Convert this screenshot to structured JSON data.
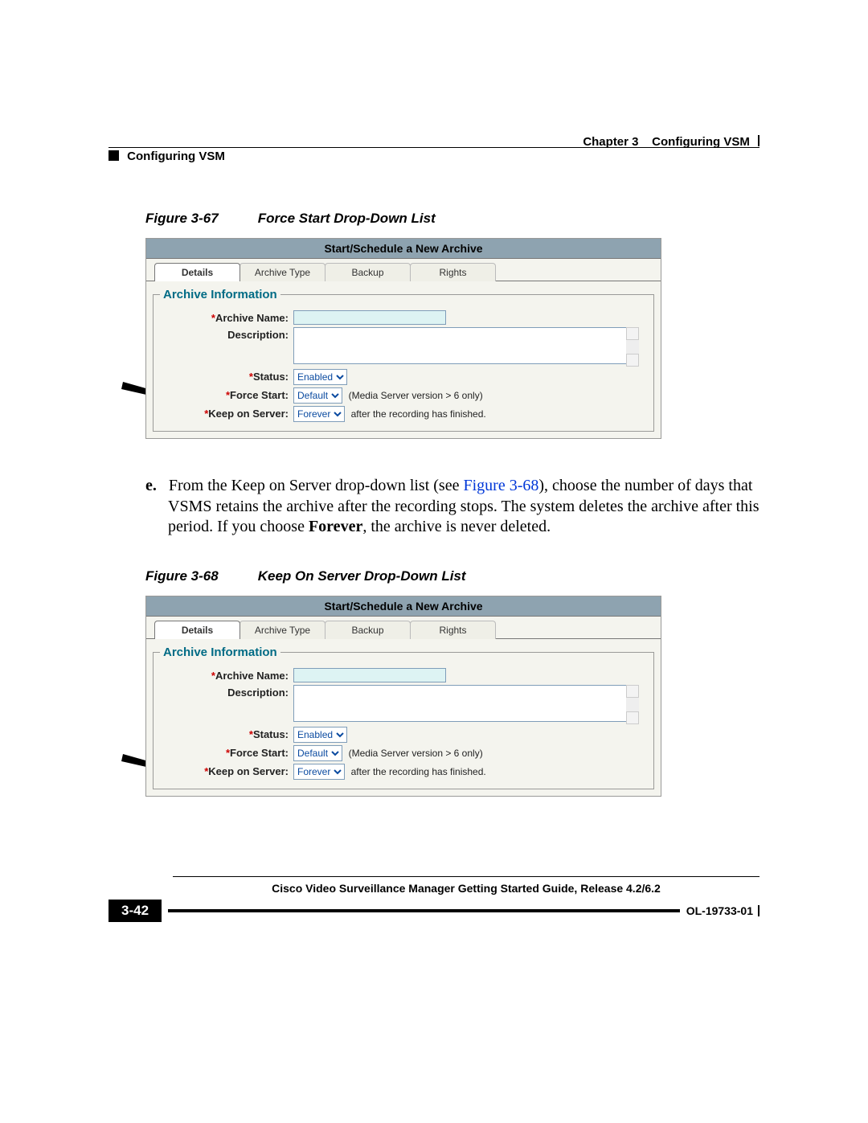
{
  "header": {
    "chapter": "Chapter 3",
    "section_right": "Configuring VSM",
    "section_left": "Configuring VSM"
  },
  "figures": {
    "f67": {
      "num": "Figure 3-67",
      "title": "Force Start Drop-Down List"
    },
    "f68": {
      "num": "Figure 3-68",
      "title": "Keep On Server Drop-Down List"
    }
  },
  "screenshot": {
    "window_title": "Start/Schedule a New Archive",
    "tabs": [
      "Details",
      "Archive Type",
      "Backup",
      "Rights"
    ],
    "legend": "Archive Information",
    "labels": {
      "archive_name": "*Archive Name:",
      "description": "Description:",
      "status": "*Status:",
      "force_start": "*Force Start:",
      "keep_on_server": "*Keep on Server:"
    },
    "values": {
      "status": "Enabled",
      "force_start": "Default",
      "keep_on_server": "Forever",
      "force_start_hint": "(Media Server version > 6 only)",
      "keep_hint": "after the recording has finished."
    }
  },
  "body": {
    "marker": "e.",
    "text_a": "From the Keep on Server drop-down list (see ",
    "link": "Figure 3-68",
    "text_b": "), choose the number of days that VSMS retains the archive after the recording stops. The system deletes the archive after this period. If you choose ",
    "text_bold": "Forever",
    "text_c": ", the archive is never deleted."
  },
  "footer": {
    "title": "Cisco Video Surveillance Manager Getting Started Guide, Release 4.2/6.2",
    "pagenum": "3-42",
    "docid": "OL-19733-01"
  }
}
